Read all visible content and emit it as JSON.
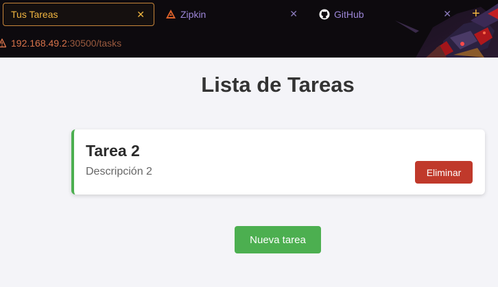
{
  "browser": {
    "tabs": [
      {
        "label": "Tus Tareas",
        "icon": "none",
        "active": true
      },
      {
        "label": "Zipkin",
        "icon": "zipkin-icon",
        "active": false
      },
      {
        "label": "GitHub",
        "icon": "github-icon",
        "active": false
      }
    ],
    "close_glyph": "✕",
    "new_tab_glyph": "+",
    "url": {
      "host": "192.168.49.2",
      "rest": ":30500/tasks"
    },
    "colors": {
      "accent": "#f2b640",
      "inactive_tab": "#9d86d8",
      "url": "#d9734a"
    }
  },
  "page": {
    "title": "Lista de Tareas",
    "tasks": [
      {
        "title": "Tarea 2",
        "description": "Descripción 2",
        "delete_label": "Eliminar"
      }
    ],
    "new_task_label": "Nueva tarea",
    "colors": {
      "card_border": "#4caf50",
      "delete_button": "#c0392b",
      "new_button": "#4caf50"
    }
  }
}
